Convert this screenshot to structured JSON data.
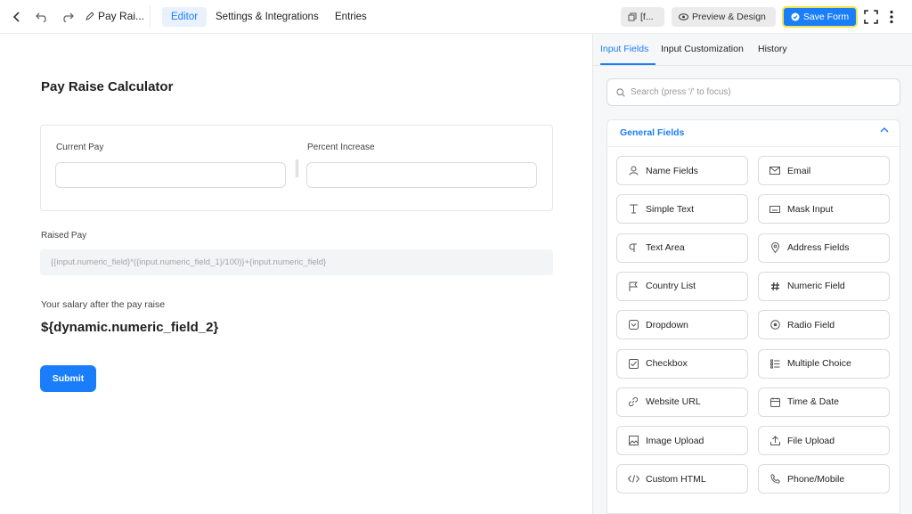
{
  "topbar": {
    "form_title": "Pay Rai...",
    "tabs": [
      "Editor",
      "Settings & Integrations",
      "Entries"
    ],
    "shortcode_label": "[f...",
    "preview_label": "Preview & Design",
    "save_label": "Save Form"
  },
  "form": {
    "title": "Pay Raise Calculator",
    "current_pay_label": "Current Pay",
    "percent_increase_label": "Percent Increase",
    "raised_pay_label": "Raised Pay",
    "raised_pay_formula": "{{input.numeric_field}*({input.numeric_field_1}/100)}+{input.numeric_field}",
    "hint_text": "Your salary after the pay raise",
    "dynamic_value": "${dynamic.numeric_field_2}",
    "submit_label": "Submit"
  },
  "panel": {
    "tabs": [
      "Input Fields",
      "Input Customization",
      "History"
    ],
    "search_placeholder": "Search (press '/' to focus)",
    "section_title": "General Fields",
    "fields": [
      {
        "label": "Name Fields",
        "icon": "person-icon"
      },
      {
        "label": "Email",
        "icon": "envelope-icon"
      },
      {
        "label": "Simple Text",
        "icon": "text-cursor-icon"
      },
      {
        "label": "Mask Input",
        "icon": "keyboard-icon"
      },
      {
        "label": "Text Area",
        "icon": "paragraph-icon"
      },
      {
        "label": "Address Fields",
        "icon": "map-pin-icon"
      },
      {
        "label": "Country List",
        "icon": "flag-icon"
      },
      {
        "label": "Numeric Field",
        "icon": "hash-icon"
      },
      {
        "label": "Dropdown",
        "icon": "dropdown-icon"
      },
      {
        "label": "Radio Field",
        "icon": "radio-icon"
      },
      {
        "label": "Checkbox",
        "icon": "checkbox-icon"
      },
      {
        "label": "Multiple Choice",
        "icon": "list-icon"
      },
      {
        "label": "Website URL",
        "icon": "link-icon"
      },
      {
        "label": "Time & Date",
        "icon": "calendar-icon"
      },
      {
        "label": "Image Upload",
        "icon": "image-icon"
      },
      {
        "label": "File Upload",
        "icon": "upload-icon"
      },
      {
        "label": "Custom HTML",
        "icon": "code-icon"
      },
      {
        "label": "Phone/Mobile",
        "icon": "phone-icon"
      }
    ]
  }
}
